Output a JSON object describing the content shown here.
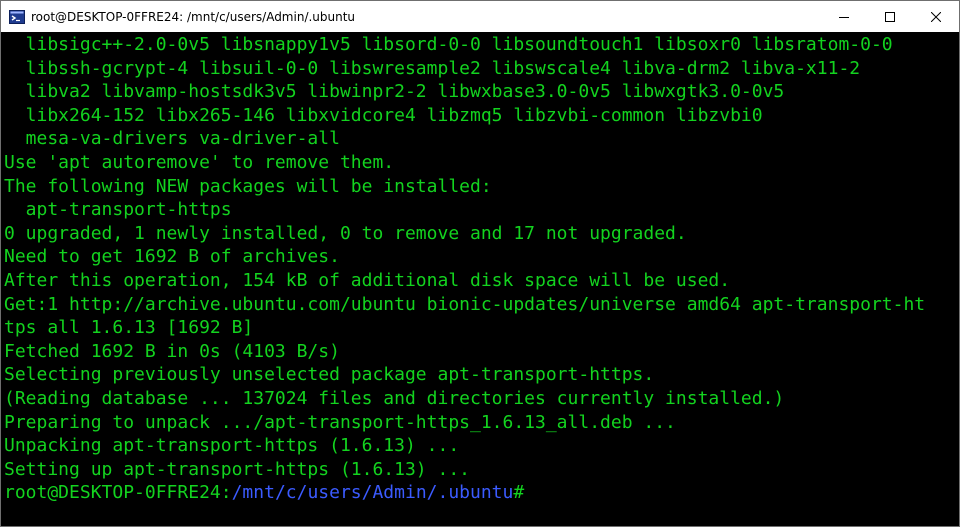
{
  "window": {
    "title": "root@DESKTOP-0FFRE24: /mnt/c/users/Admin/.ubuntu",
    "icon": "terminal-app-icon",
    "controls": {
      "minimize": "minimize-icon",
      "maximize": "maximize-icon",
      "close": "close-icon"
    }
  },
  "colors": {
    "terminal_bg": "#000000",
    "text_green": "#13d31f",
    "path_blue": "#3b5bff",
    "titlebar_bg": "#ffffff"
  },
  "terminal": {
    "lines": [
      "  libsigc++-2.0-0v5 libsnappy1v5 libsord-0-0 libsoundtouch1 libsoxr0 libsratom-0-0",
      "  libssh-gcrypt-4 libsuil-0-0 libswresample2 libswscale4 libva-drm2 libva-x11-2",
      "  libva2 libvamp-hostsdk3v5 libwinpr2-2 libwxbase3.0-0v5 libwxgtk3.0-0v5",
      "  libx264-152 libx265-146 libxvidcore4 libzmq5 libzvbi-common libzvbi0",
      "  mesa-va-drivers va-driver-all",
      "Use 'apt autoremove' to remove them.",
      "The following NEW packages will be installed:",
      "  apt-transport-https",
      "0 upgraded, 1 newly installed, 0 to remove and 17 not upgraded.",
      "Need to get 1692 B of archives.",
      "After this operation, 154 kB of additional disk space will be used.",
      "Get:1 http://archive.ubuntu.com/ubuntu bionic-updates/universe amd64 apt-transport-ht",
      "tps all 1.6.13 [1692 B]",
      "Fetched 1692 B in 0s (4103 B/s)",
      "Selecting previously unselected package apt-transport-https.",
      "(Reading database ... 137024 files and directories currently installed.)",
      "Preparing to unpack .../apt-transport-https_1.6.13_all.deb ...",
      "Unpacking apt-transport-https (1.6.13) ...",
      "Setting up apt-transport-https (1.6.13) ..."
    ],
    "prompt": {
      "user_host": "root@DESKTOP-0FFRE24",
      "separator": ":",
      "path": "/mnt/c/users/Admin/.ubuntu",
      "symbol": "#"
    }
  }
}
